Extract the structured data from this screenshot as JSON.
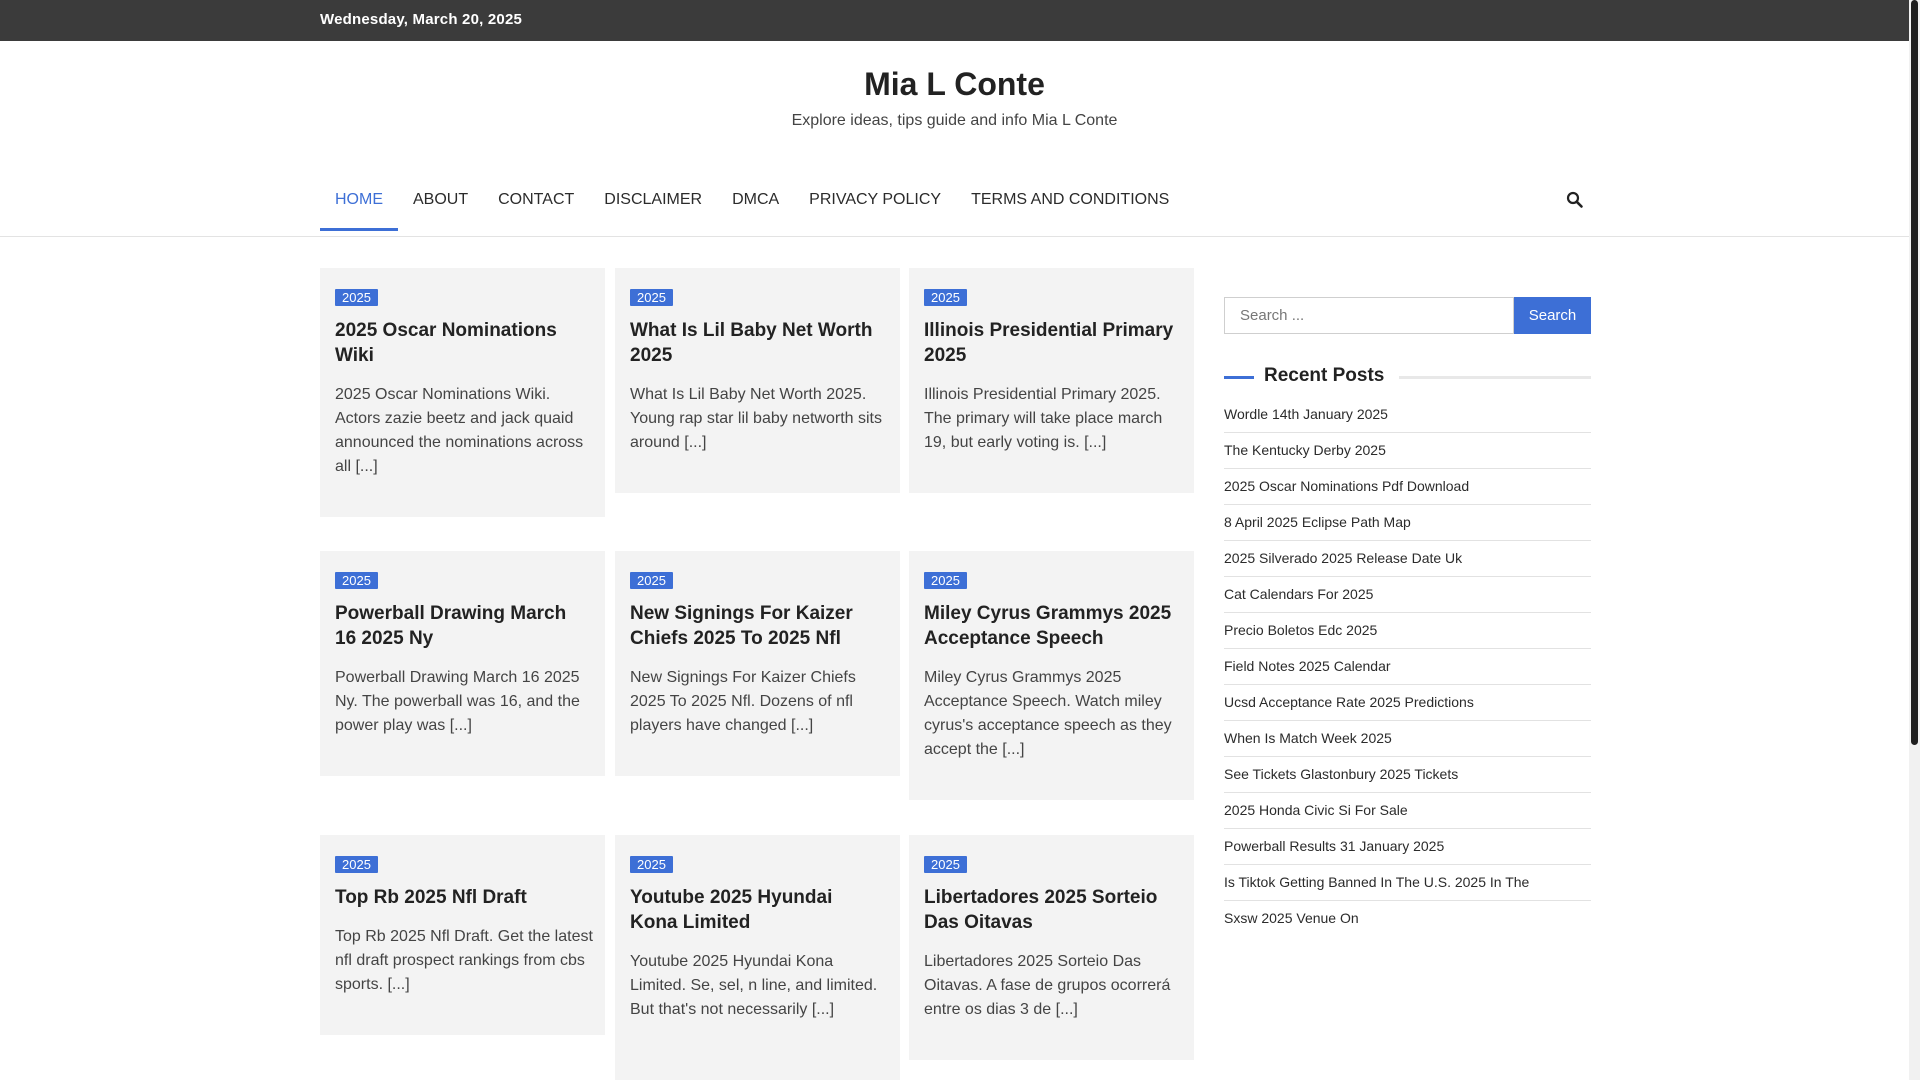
{
  "topbar": {
    "date": "Wednesday, March 20, 2025"
  },
  "site": {
    "title": "Mia L Conte",
    "tagline": "Explore ideas, tips guide and info Mia L Conte"
  },
  "nav": {
    "items": [
      {
        "label": "HOME",
        "active": true
      },
      {
        "label": "ABOUT"
      },
      {
        "label": "CONTACT"
      },
      {
        "label": "DISCLAIMER"
      },
      {
        "label": "DMCA"
      },
      {
        "label": "PRIVACY POLICY"
      },
      {
        "label": "TERMS AND CONDITIONS"
      }
    ],
    "search_icon": "search-icon"
  },
  "posts": [
    {
      "category": "2025",
      "title": "2025 Oscar Nominations Wiki",
      "excerpt": "2025 Oscar Nominations Wiki. Actors zazie beetz and jack quaid announced the nominations across all [...]"
    },
    {
      "category": "2025",
      "title": "What Is Lil Baby Net Worth 2025",
      "excerpt": "What Is Lil Baby Net Worth 2025. Young rap star lil baby networth sits around [...]"
    },
    {
      "category": "2025",
      "title": "Illinois Presidential Primary 2025",
      "excerpt": "Illinois Presidential Primary 2025. The primary will take place march 19, but early voting is. [...]"
    },
    {
      "category": "2025",
      "title": "Powerball Drawing March 16 2025 Ny",
      "excerpt": "Powerball Drawing March 16 2025 Ny. The powerball was 16, and the power play was [...]"
    },
    {
      "category": "2025",
      "title": "New Signings For Kaizer Chiefs 2025 To 2025 Nfl",
      "excerpt": "New Signings For Kaizer Chiefs 2025 To 2025 Nfl. Dozens of nfl players have changed [...]"
    },
    {
      "category": "2025",
      "title": "Miley Cyrus Grammys 2025 Acceptance Speech",
      "excerpt": "Miley Cyrus Grammys 2025 Acceptance Speech. Watch miley cyrus's acceptance speech as they accept the [...]"
    },
    {
      "category": "2025",
      "title": "Top Rb 2025 Nfl Draft",
      "excerpt": "Top Rb 2025 Nfl Draft. Get the latest nfl draft prospect rankings from cbs sports. [...]"
    },
    {
      "category": "2025",
      "title": "Youtube 2025 Hyundai Kona Limited",
      "excerpt": "Youtube 2025 Hyundai Kona Limited. Se, sel, n line, and limited. But that's not necessarily [...]"
    },
    {
      "category": "2025",
      "title": "Libertadores 2025 Sorteio Das Oitavas",
      "excerpt": "Libertadores 2025 Sorteio Das Oitavas. A fase de grupos ocorrerá entre os dias 3 de [...]"
    }
  ],
  "sidebar": {
    "search": {
      "placeholder": "Search ...",
      "value": "",
      "button": "Search"
    },
    "recent_title": "Recent Posts",
    "recent_posts": [
      "Wordle 14th January 2025",
      "The Kentucky Derby 2025",
      "2025 Oscar Nominations Pdf Download",
      "8 April 2025 Eclipse Path Map",
      "2025 Silverado 2025 Release Date Uk",
      "Cat Calendars For 2025",
      "Precio Boletos Edc 2025",
      "Field Notes 2025 Calendar",
      "Ucsd Acceptance Rate 2025 Predictions",
      "When Is Match Week 2025",
      "See Tickets Glastonbury 2025 Tickets",
      "2025 Honda Civic Si For Sale",
      "Powerball Results 31 January 2025",
      "Is Tiktok Getting Banned In The U.S. 2025 In The",
      "Sxsw 2025 Venue On"
    ]
  },
  "colors": {
    "accent": "#3d6fd6",
    "topbar": "#3b3b3b",
    "card_bg": "#f3f3f3"
  }
}
